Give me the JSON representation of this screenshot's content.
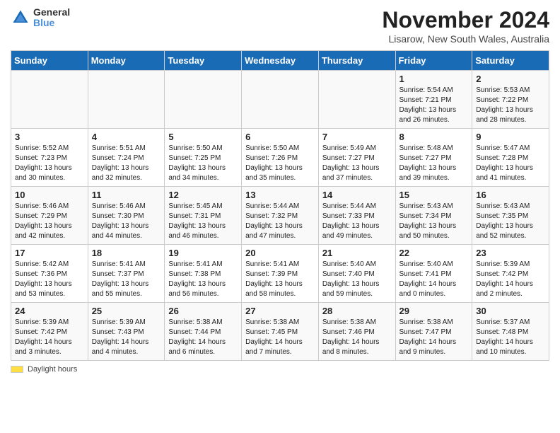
{
  "header": {
    "logo_line1": "General",
    "logo_line2": "Blue",
    "title": "November 2024",
    "location": "Lisarow, New South Wales, Australia"
  },
  "days_of_week": [
    "Sunday",
    "Monday",
    "Tuesday",
    "Wednesday",
    "Thursday",
    "Friday",
    "Saturday"
  ],
  "weeks": [
    [
      {
        "day": "",
        "info": ""
      },
      {
        "day": "",
        "info": ""
      },
      {
        "day": "",
        "info": ""
      },
      {
        "day": "",
        "info": ""
      },
      {
        "day": "",
        "info": ""
      },
      {
        "day": "1",
        "info": "Sunrise: 5:54 AM\nSunset: 7:21 PM\nDaylight: 13 hours and 26 minutes."
      },
      {
        "day": "2",
        "info": "Sunrise: 5:53 AM\nSunset: 7:22 PM\nDaylight: 13 hours and 28 minutes."
      }
    ],
    [
      {
        "day": "3",
        "info": "Sunrise: 5:52 AM\nSunset: 7:23 PM\nDaylight: 13 hours and 30 minutes."
      },
      {
        "day": "4",
        "info": "Sunrise: 5:51 AM\nSunset: 7:24 PM\nDaylight: 13 hours and 32 minutes."
      },
      {
        "day": "5",
        "info": "Sunrise: 5:50 AM\nSunset: 7:25 PM\nDaylight: 13 hours and 34 minutes."
      },
      {
        "day": "6",
        "info": "Sunrise: 5:50 AM\nSunset: 7:26 PM\nDaylight: 13 hours and 35 minutes."
      },
      {
        "day": "7",
        "info": "Sunrise: 5:49 AM\nSunset: 7:27 PM\nDaylight: 13 hours and 37 minutes."
      },
      {
        "day": "8",
        "info": "Sunrise: 5:48 AM\nSunset: 7:27 PM\nDaylight: 13 hours and 39 minutes."
      },
      {
        "day": "9",
        "info": "Sunrise: 5:47 AM\nSunset: 7:28 PM\nDaylight: 13 hours and 41 minutes."
      }
    ],
    [
      {
        "day": "10",
        "info": "Sunrise: 5:46 AM\nSunset: 7:29 PM\nDaylight: 13 hours and 42 minutes."
      },
      {
        "day": "11",
        "info": "Sunrise: 5:46 AM\nSunset: 7:30 PM\nDaylight: 13 hours and 44 minutes."
      },
      {
        "day": "12",
        "info": "Sunrise: 5:45 AM\nSunset: 7:31 PM\nDaylight: 13 hours and 46 minutes."
      },
      {
        "day": "13",
        "info": "Sunrise: 5:44 AM\nSunset: 7:32 PM\nDaylight: 13 hours and 47 minutes."
      },
      {
        "day": "14",
        "info": "Sunrise: 5:44 AM\nSunset: 7:33 PM\nDaylight: 13 hours and 49 minutes."
      },
      {
        "day": "15",
        "info": "Sunrise: 5:43 AM\nSunset: 7:34 PM\nDaylight: 13 hours and 50 minutes."
      },
      {
        "day": "16",
        "info": "Sunrise: 5:43 AM\nSunset: 7:35 PM\nDaylight: 13 hours and 52 minutes."
      }
    ],
    [
      {
        "day": "17",
        "info": "Sunrise: 5:42 AM\nSunset: 7:36 PM\nDaylight: 13 hours and 53 minutes."
      },
      {
        "day": "18",
        "info": "Sunrise: 5:41 AM\nSunset: 7:37 PM\nDaylight: 13 hours and 55 minutes."
      },
      {
        "day": "19",
        "info": "Sunrise: 5:41 AM\nSunset: 7:38 PM\nDaylight: 13 hours and 56 minutes."
      },
      {
        "day": "20",
        "info": "Sunrise: 5:41 AM\nSunset: 7:39 PM\nDaylight: 13 hours and 58 minutes."
      },
      {
        "day": "21",
        "info": "Sunrise: 5:40 AM\nSunset: 7:40 PM\nDaylight: 13 hours and 59 minutes."
      },
      {
        "day": "22",
        "info": "Sunrise: 5:40 AM\nSunset: 7:41 PM\nDaylight: 14 hours and 0 minutes."
      },
      {
        "day": "23",
        "info": "Sunrise: 5:39 AM\nSunset: 7:42 PM\nDaylight: 14 hours and 2 minutes."
      }
    ],
    [
      {
        "day": "24",
        "info": "Sunrise: 5:39 AM\nSunset: 7:42 PM\nDaylight: 14 hours and 3 minutes."
      },
      {
        "day": "25",
        "info": "Sunrise: 5:39 AM\nSunset: 7:43 PM\nDaylight: 14 hours and 4 minutes."
      },
      {
        "day": "26",
        "info": "Sunrise: 5:38 AM\nSunset: 7:44 PM\nDaylight: 14 hours and 6 minutes."
      },
      {
        "day": "27",
        "info": "Sunrise: 5:38 AM\nSunset: 7:45 PM\nDaylight: 14 hours and 7 minutes."
      },
      {
        "day": "28",
        "info": "Sunrise: 5:38 AM\nSunset: 7:46 PM\nDaylight: 14 hours and 8 minutes."
      },
      {
        "day": "29",
        "info": "Sunrise: 5:38 AM\nSunset: 7:47 PM\nDaylight: 14 hours and 9 minutes."
      },
      {
        "day": "30",
        "info": "Sunrise: 5:37 AM\nSunset: 7:48 PM\nDaylight: 14 hours and 10 minutes."
      }
    ]
  ],
  "footer": {
    "daylight_label": "Daylight hours"
  }
}
